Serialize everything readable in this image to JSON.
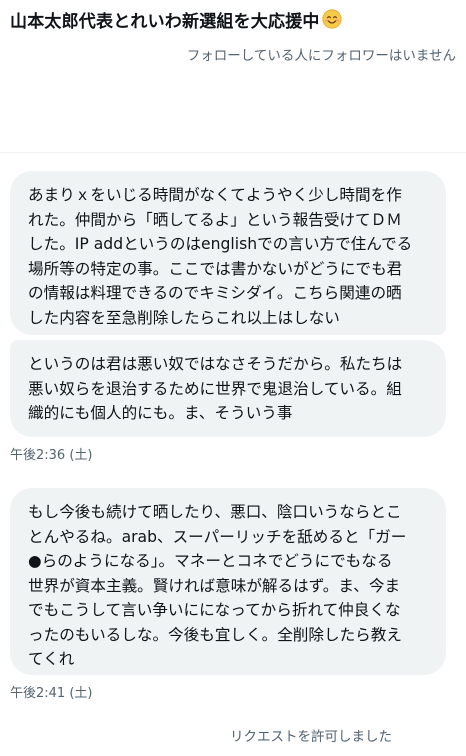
{
  "header": {
    "title": "山本太郎代表とれいわ新選組を大応援中",
    "title_emoji": "smiling-face-emoji",
    "subtitle": "フォローしている人にフォロワーはいません"
  },
  "messages": [
    {
      "lines": [
        "あまりｘをいじる時間がなくてようやく少し時間を作",
        "れた。仲間から「晒してるよ」という報告受けてＤＭ",
        "した。IP addというのはenglishでの言い方で住んでる",
        "場所等の特定の事。ここでは書かないがどうにでも君",
        "の情報は料理できるのでキミシダイ。こちら関連の晒",
        "した内容を至急削除したらこれ以上はしない"
      ]
    },
    {
      "lines": [
        "というのは君は悪い奴ではなさそうだから。私たちは",
        "悪い奴らを退治するために世界で鬼退治している。組",
        "織的にも個人的にも。ま、そういう事"
      ],
      "timestamp": "午後2:36 (土)"
    },
    {
      "lines": [
        "もし今後も続けて晒したり、悪口、陰口いうならとこ",
        "とんやるね。arab、スーパーリッチを舐めると「ガー",
        "●らのようになる」。マネーとコネでどうにでもなる",
        "世界が資本主義。賢ければ意味が解るはず。ま、今ま",
        "でもこうして言い争いにになってから折れて仲良くな",
        "ったのもいるしな。今後も宜しく。全削除したら教え",
        "てくれ"
      ],
      "timestamp": "午後2:41 (土)"
    }
  ],
  "footer": {
    "notice": "リクエストを許可しました"
  },
  "colors": {
    "bubble_bg": "#eff3f4",
    "text": "#0f1419",
    "secondary_text": "#536471",
    "emoji_face": "#f7c948",
    "emoji_cheek": "#f28b82"
  }
}
